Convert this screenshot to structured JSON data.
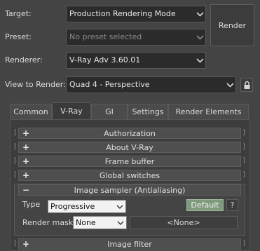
{
  "labels": {
    "target": "Target:",
    "preset": "Preset:",
    "renderer": "Renderer:",
    "view_to_render": "View to Render:"
  },
  "fields": {
    "target": "Production Rendering Mode",
    "preset": "No preset selected",
    "renderer": "V-Ray Adv 3.60.01",
    "view": "Quad 4 - Perspective"
  },
  "render_button": "Render",
  "tabs": [
    {
      "label": "Common",
      "active": false
    },
    {
      "label": "V-Ray",
      "active": true
    },
    {
      "label": "GI",
      "active": false
    },
    {
      "label": "Settings",
      "active": false
    },
    {
      "label": "Render Elements",
      "active": false
    }
  ],
  "rollouts": [
    {
      "label": "Authorization",
      "sign": "+"
    },
    {
      "label": "About V-Ray",
      "sign": "+"
    },
    {
      "label": "Frame buffer",
      "sign": "+"
    },
    {
      "label": "Global switches",
      "sign": "+"
    },
    {
      "label": "Image sampler (Antialiasing)",
      "sign": "−"
    }
  ],
  "image_sampler": {
    "type_label": "Type",
    "type_value": "Progressive",
    "default_button": "Default",
    "help_button": "?",
    "render_mask_label": "Render mask",
    "render_mask_value": "None",
    "render_mask_object": "<None>"
  },
  "image_filter": {
    "label": "Image filter",
    "sign": "+"
  },
  "colors": {
    "panel_bg": "#444444",
    "field_bg": "#2b2b2b",
    "default_btn_bg": "#7f9a7d"
  },
  "icons": [
    "chevron-down-icon",
    "lock-icon"
  ]
}
